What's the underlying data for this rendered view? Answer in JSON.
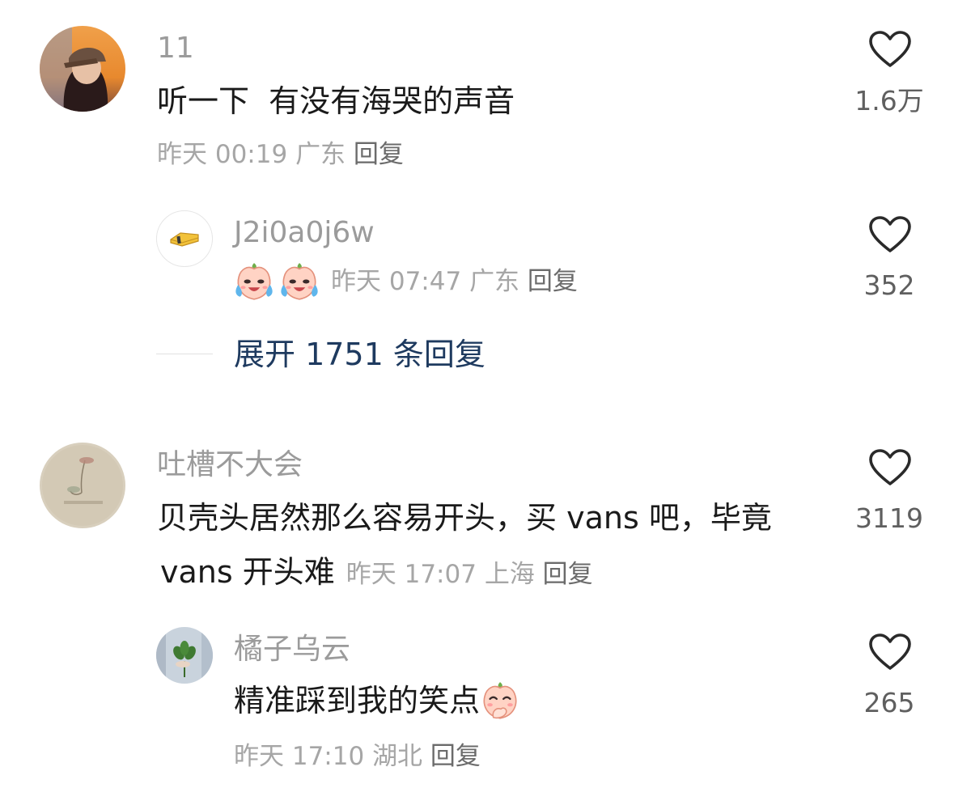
{
  "comments": [
    {
      "username": "11",
      "text": "听一下  有没有海哭的声音",
      "time": "昨天 00:19",
      "location": "广东",
      "reply_label": "回复",
      "likes": "1.6万",
      "replies": [
        {
          "username": "J2i0a0j6w",
          "time": "昨天 07:47",
          "location": "广东",
          "reply_label": "回复",
          "likes": "352"
        }
      ],
      "expand_label": "展开 1751 条回复"
    },
    {
      "username": "吐槽不大会",
      "text_line1": "贝壳头居然那么容易开头，买 vans 吧，毕竟",
      "text_line2": "vans 开头难",
      "time": "昨天 17:07",
      "location": "上海",
      "reply_label": "回复",
      "likes": "3119",
      "replies": [
        {
          "username": "橘子乌云",
          "text": "精准踩到我的笑点",
          "time": "昨天 17:10",
          "location": "湖北",
          "reply_label": "回复",
          "likes": "265"
        }
      ]
    }
  ],
  "colors": {
    "username": "#9b9b9b",
    "content": "#1a1a1a",
    "meta": "#a6a6a6",
    "expand_link": "#1e3a5f"
  },
  "icons": [
    "heart-outline-icon",
    "crying-peach-emoji",
    "laughing-peach-emoji"
  ]
}
